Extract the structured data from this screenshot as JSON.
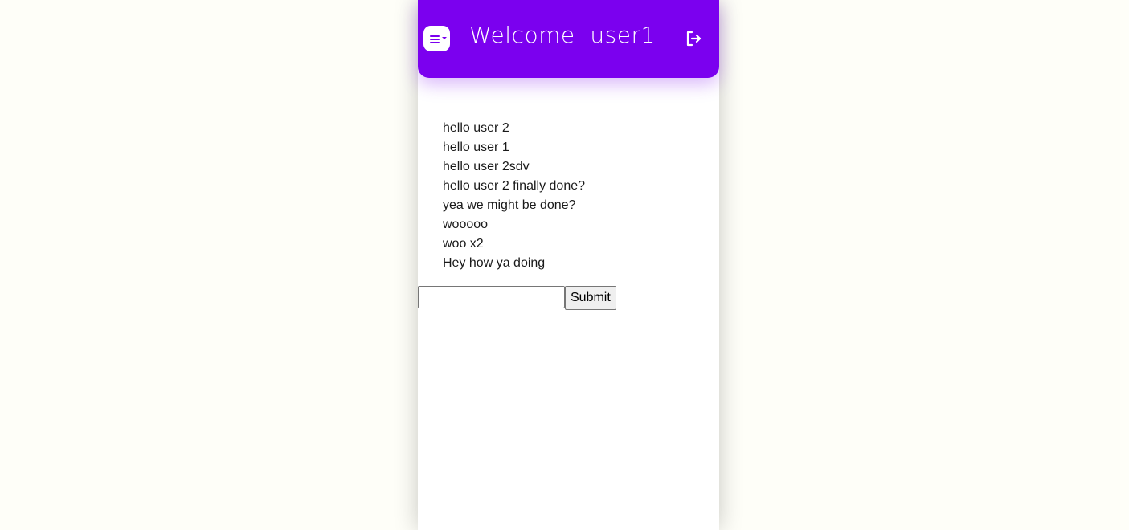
{
  "header": {
    "title": "Welcome  user1",
    "menu_icon": "menu-icon",
    "logout_icon": "logout-icon",
    "accent_color": "#7b00ef"
  },
  "messages": [
    "hello user 2",
    "hello user 1",
    "hello user 2sdv",
    "hello user 2 finally done?",
    "yea we might be done?",
    "wooooo",
    "woo x2",
    "Hey how ya doing"
  ],
  "composer": {
    "input_value": "",
    "submit_label": "Submit"
  }
}
